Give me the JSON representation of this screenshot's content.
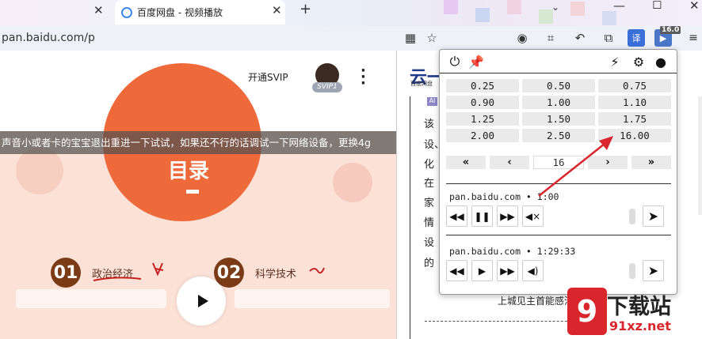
{
  "browser": {
    "active_tab_title": "百度网盘 - 视频播放",
    "url": "pan.baidu.com/p",
    "extension_badge": "16.0"
  },
  "page": {
    "open_svip": "开通SVIP",
    "svip_badge": "SVIP1",
    "notice": "声音小或者卡的宝宝退出重进一下试试，如果还不行的话调试一下网络设备，更换4g",
    "cover_title": "目录",
    "topics": [
      {
        "num": "01",
        "label": "政治经济"
      },
      {
        "num": "02",
        "label": "科学技术"
      }
    ]
  },
  "right_page": {
    "logo_sub": "百度网盘",
    "text_fragments": [
      "该",
      "设、",
      "化",
      "在",
      "家",
      "情",
      "设",
      "的"
    ],
    "bottom_text": "上城见主首能感活"
  },
  "popup": {
    "speeds": [
      [
        "0.25",
        "0.50",
        "0.75"
      ],
      [
        "0.90",
        "1.00",
        "1.10"
      ],
      [
        "1.25",
        "1.50",
        "1.75"
      ],
      [
        "2.00",
        "2.50",
        "16.00"
      ]
    ],
    "nav": {
      "first": "«",
      "prev": "‹",
      "current": "16",
      "next": "›",
      "last": "»"
    },
    "media": [
      {
        "source": "pan.baidu.com • 1:00",
        "play_state": "paused",
        "muted": true
      },
      {
        "source": "pan.baidu.com • 1:29:33",
        "play_state": "stopped",
        "muted": false
      }
    ]
  },
  "watermark": {
    "brand": "下载站",
    "domain": "91xz.net"
  },
  "colors": {
    "orange": "#ef6a3b",
    "arrow_red": "#d9262c"
  }
}
